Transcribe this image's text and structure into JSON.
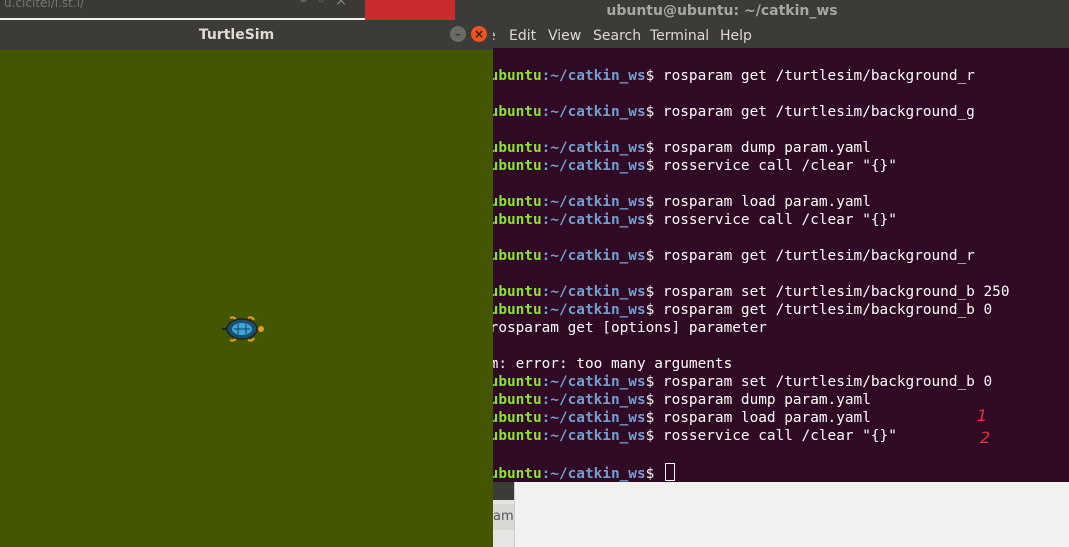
{
  "background_window": {
    "title_fragment": "u.cicitei/i.st.i/"
  },
  "terminal": {
    "title": "ubuntu@ubuntu: ~/catkin_ws",
    "menu": [
      "e",
      "Edit",
      "View",
      "Search",
      "Terminal",
      "Help"
    ],
    "prompt_user": "ntu@ubuntu",
    "prompt_path": ":~/catkin_ws",
    "lines": [
      {
        "type": "cmd",
        "text": "$ rosparam get /turtlesim/background_r"
      },
      {
        "type": "out",
        "text": ""
      },
      {
        "type": "cmd",
        "text": "$ rosparam get /turtlesim/background_g"
      },
      {
        "type": "out",
        "text": ""
      },
      {
        "type": "cmd",
        "text": "$ rosparam dump param.yaml"
      },
      {
        "type": "cmd",
        "text": "$ rosservice call /clear \"{}\""
      },
      {
        "type": "out",
        "text": ""
      },
      {
        "type": "cmd",
        "text": "$ rosparam load param.yaml"
      },
      {
        "type": "cmd",
        "text": "$ rosservice call /clear \"{}\""
      },
      {
        "type": "out",
        "text": ""
      },
      {
        "type": "cmd",
        "text": "$ rosparam get /turtlesim/background_r"
      },
      {
        "type": "out",
        "text": ""
      },
      {
        "type": "cmd",
        "text": "$ rosparam set /turtlesim/background_b 250"
      },
      {
        "type": "cmd",
        "text": "$ rosparam get /turtlesim/background_b 0"
      },
      {
        "type": "out",
        "text": "ge: rosparam get [options] parameter"
      },
      {
        "type": "out",
        "text": ""
      },
      {
        "type": "out",
        "text": "param: error: too many arguments"
      },
      {
        "type": "cmd",
        "text": "$ rosparam set /turtlesim/background_b 0"
      },
      {
        "type": "cmd",
        "text": "$ rosparam dump param.yaml"
      },
      {
        "type": "cmd",
        "text": "$ rosparam load param.yaml"
      },
      {
        "type": "cmd",
        "text": "$ rosservice call /clear \"{}\""
      },
      {
        "type": "out",
        "text": ""
      },
      {
        "type": "prompt",
        "text": "$ "
      }
    ],
    "annotations": [
      "1",
      "2"
    ]
  },
  "turtlesim": {
    "title": "TurtleSim",
    "background_color": "#455600",
    "minimize_symbol": "–",
    "close_symbol": "×"
  },
  "lower_window": {
    "tab_fragment": "am"
  }
}
